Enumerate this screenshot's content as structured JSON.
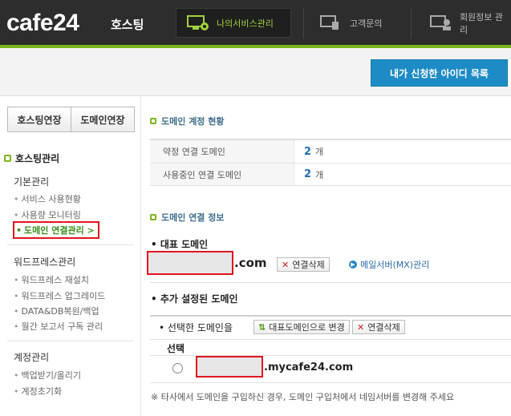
{
  "header": {
    "logo": "cafe24",
    "logo_sub": "호스팅",
    "nav": {
      "my_service": "나의서비스관리",
      "support": "고객문의",
      "member": "회원정보 관리"
    },
    "colors": {
      "bg": "#2d2d2d",
      "accent": "#9fd23a",
      "green_bar": "#7ab51d"
    }
  },
  "top_button": "내가 신청한 아이디 목록",
  "sidebar": {
    "tabs": [
      "호스팅연장",
      "도메인연장"
    ],
    "title": "호스팅관리",
    "groups": [
      {
        "title": "기본관리",
        "items": [
          "서비스 사용현황",
          "사용량 모니터링",
          "도메인 연결관리 >"
        ]
      },
      {
        "title": "워드프레스관리",
        "items": [
          "워드프레스 재설치",
          "워드프레스 업그레이드",
          "DATA&DB복원/백업",
          "월간 보고서 구독 관리"
        ]
      },
      {
        "title": "계정관리",
        "items": [
          "백업받기/올리기",
          "계정초기화"
        ]
      }
    ],
    "active_item": "도메인 연결관리 >"
  },
  "main": {
    "status_title": "도메인 계정 현황",
    "stats": [
      {
        "label": "약정 연결 도메인",
        "value": "2",
        "unit": "개"
      },
      {
        "label": "사용중인 연결 도메인",
        "value": "2",
        "unit": "개"
      }
    ],
    "info_title": "도메인 연결 정보",
    "primary_label": "• 대표 도메인",
    "primary_suffix": ".com",
    "disconnect_btn": "연결삭제",
    "mx_link": "메일서버(MX)관리",
    "extra_label": "• 추가 설정된 도메인",
    "selected_label": "• 선택한 도메인을",
    "make_primary_btn": "대표도메인으로 변경",
    "disconnect_btn2": "연결삭제",
    "col_select": "선택",
    "extra_suffix": ".mycafe24.com",
    "notice": "※ 타사에서 도메인을 구입하신 경우, 도메인 구입처에서 네임서버를 변경해 주세요"
  }
}
